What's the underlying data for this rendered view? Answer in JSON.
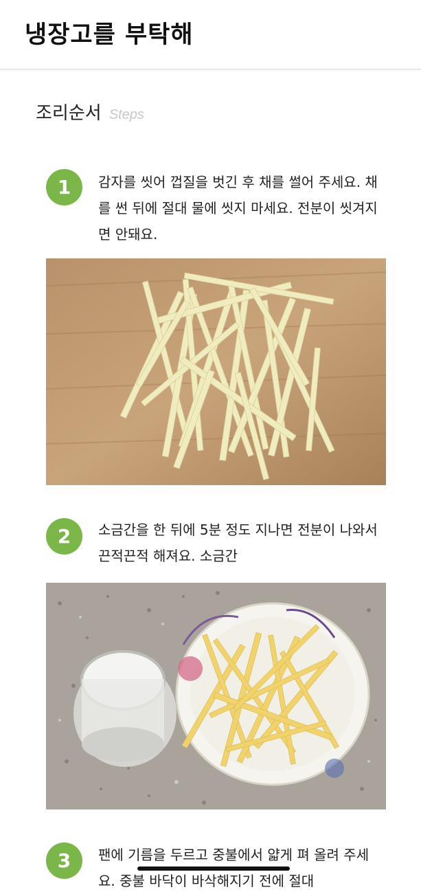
{
  "header": {
    "title": "냉장고를 부탁해"
  },
  "section": {
    "title": "조리순서",
    "subtitle": "Steps"
  },
  "steps": [
    {
      "number": "1",
      "text": "감자를 씻어 껍질을 벗긴 후 채를 썰어 주세요. 채를 썬 뒤에 절대 물에 씻지 마세요. 전분이 씻겨지면 안돼요."
    },
    {
      "number": "2",
      "text": "소금간을 한 뒤에 5분 정도 지나면 전분이 나와서 끈적끈적 해져요. 소금간"
    },
    {
      "number": "3",
      "text": "팬에 기름을 두르고 중불에서 얇게 펴 올려 주세요. 중불 바닥이 바삭해지기 전에 절대"
    }
  ],
  "colors": {
    "accent": "#7ab648"
  }
}
